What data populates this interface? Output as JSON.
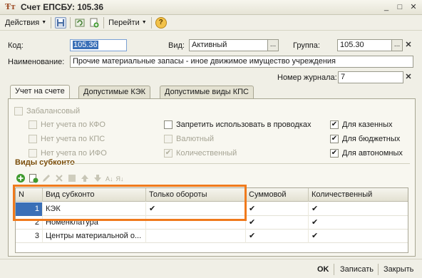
{
  "window": {
    "title": "Счет ЕПСБУ: 105.36",
    "app_icon": "1C",
    "minimize": "_",
    "maximize": "□",
    "close": "✕"
  },
  "toolbar": {
    "actions_label": "Действия",
    "goto_label": "Перейти",
    "help_icon": "?"
  },
  "form": {
    "code_label": "Код:",
    "code_value": "105.36",
    "kind_label": "Вид:",
    "kind_value": "Активный",
    "group_label": "Группа:",
    "group_value": "105.30",
    "name_label": "Наименование:",
    "name_value": "Прочие материальные запасы - иное движимое имущество учреждения",
    "journal_label": "Номер журнала:",
    "journal_value": "7",
    "select_btn": "...",
    "clear_btn": "✕"
  },
  "tabs": [
    {
      "label": "Учет на счете",
      "active": true
    },
    {
      "label": "Допустимые КЭК",
      "active": false
    },
    {
      "label": "Допустимые виды КПС",
      "active": false
    }
  ],
  "checkboxes": {
    "off_balance": {
      "label": "Забалансовый",
      "checked": false
    },
    "no_kfo": {
      "label": "Нет учета по КФО",
      "checked": false
    },
    "no_kps": {
      "label": "Нет учета по КПС",
      "checked": false
    },
    "no_ifo": {
      "label": "Нет учета по ИФО",
      "checked": false
    },
    "forbid_postings": {
      "label": "Запретить использовать в проводках",
      "checked": false
    },
    "currency": {
      "label": "Валютный",
      "checked": false
    },
    "quantity": {
      "label": "Количественный",
      "checked": true
    },
    "treasury": {
      "label": "Для казенных",
      "checked": true
    },
    "budget": {
      "label": "Для бюджетных",
      "checked": true
    },
    "autonomous": {
      "label": "Для автономных",
      "checked": true
    }
  },
  "subconto": {
    "section_title": "Виды субконто",
    "columns": [
      "N",
      "Вид субконто",
      "Только обороты",
      "Суммовой",
      "Количественный"
    ],
    "rows": [
      {
        "n": "1",
        "name": "КЭК",
        "turnover_only": "✔",
        "sum": "✔",
        "quantity": "✔"
      },
      {
        "n": "2",
        "name": "Номенклатура",
        "turnover_only": "",
        "sum": "✔",
        "quantity": "✔"
      },
      {
        "n": "3",
        "name": "Центры материальной о...",
        "turnover_only": "",
        "sum": "✔",
        "quantity": "✔"
      }
    ]
  },
  "footer": {
    "ok_label": "OK",
    "save_label": "Записать",
    "close_label": "Закрыть"
  },
  "colors": {
    "highlight": "#f07a1c",
    "section_title": "#7a4d0a",
    "selection": "#3a6fb7"
  }
}
